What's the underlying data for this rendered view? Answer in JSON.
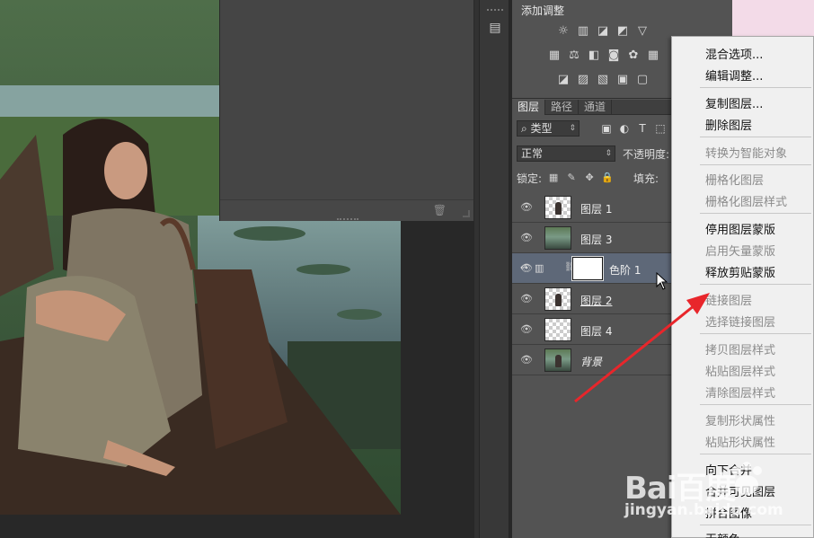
{
  "adjustments": {
    "title": "添加调整",
    "row1": [
      "sun-icon",
      "levels-icon",
      "curves-icon",
      "exposure-icon",
      "triangle-down-icon"
    ],
    "row2": [
      "vibrance-icon",
      "balance-icon",
      "bw-icon",
      "photo-filter-icon",
      "mixer-icon",
      "grid-icon"
    ],
    "row3": [
      "invert-icon",
      "posterize-icon",
      "threshold-icon",
      "gradient-map-icon",
      "selective-color-icon"
    ]
  },
  "layers_panel": {
    "tabs": [
      "图层",
      "路径",
      "通道"
    ],
    "filter_kind": "类型",
    "blend_mode": "正常",
    "opacity_label": "不透明度:",
    "lock_label": "锁定:",
    "fill_label": "填充:",
    "layers": [
      {
        "name": "图层 1",
        "thumb": "transparent"
      },
      {
        "name": "图层 3",
        "thumb": "photo"
      },
      {
        "name": "色阶 1",
        "thumb": "mask",
        "selected": true
      },
      {
        "name": "图层 2",
        "thumb": "transparent"
      },
      {
        "name": "图层 4",
        "thumb": "transparent"
      },
      {
        "name": "背景",
        "thumb": "photo"
      }
    ]
  },
  "context_menu": {
    "items": [
      {
        "label": "混合选项...",
        "enabled": true
      },
      {
        "label": "编辑调整...",
        "enabled": true
      },
      {
        "label": "复制图层...",
        "enabled": true
      },
      {
        "label": "删除图层",
        "enabled": true
      },
      {
        "label": "转换为智能对象",
        "enabled": false
      },
      {
        "label": "栅格化图层",
        "enabled": false
      },
      {
        "label": "栅格化图层样式",
        "enabled": false
      },
      {
        "label": "停用图层蒙版",
        "enabled": true
      },
      {
        "label": "启用矢量蒙版",
        "enabled": false
      },
      {
        "label": "释放剪贴蒙版",
        "enabled": true
      },
      {
        "label": "链接图层",
        "enabled": false
      },
      {
        "label": "选择链接图层",
        "enabled": false
      },
      {
        "label": "拷贝图层样式",
        "enabled": false
      },
      {
        "label": "粘贴图层样式",
        "enabled": false
      },
      {
        "label": "清除图层样式",
        "enabled": false
      },
      {
        "label": "复制形状属性",
        "enabled": false
      },
      {
        "label": "粘贴形状属性",
        "enabled": false
      },
      {
        "label": "向下合并",
        "enabled": true
      },
      {
        "label": "合并可见图层",
        "enabled": true
      },
      {
        "label": "拼合图像",
        "enabled": true
      },
      {
        "label": "无颜色",
        "enabled": true
      }
    ]
  },
  "watermark": {
    "logo": "Bai百度",
    "url": "jingyan.baidu.com"
  },
  "colors": {
    "panel_bg": "#535353",
    "selected_layer": "#5e6878",
    "menu_bg": "#f0f0f0",
    "arrow": "#e8262b"
  }
}
